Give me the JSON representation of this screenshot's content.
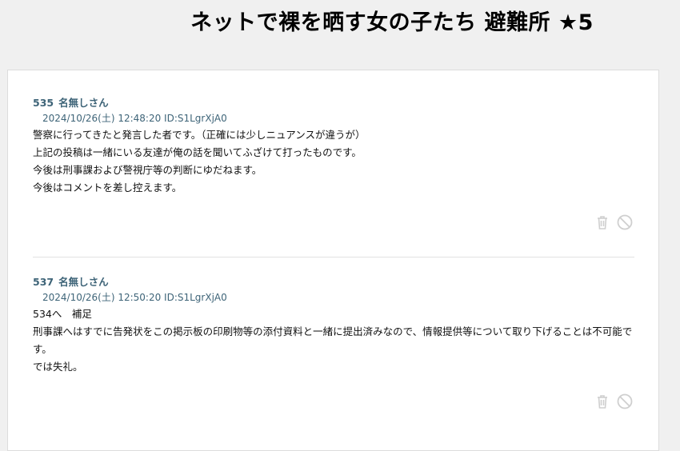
{
  "page": {
    "title": "ネットで裸を晒す女の子たち 避難所 ★5"
  },
  "posts": [
    {
      "number": "535",
      "name": "名無しさん",
      "meta": "2024/10/26(土) 12:48:20 ID:S1LgrXjA0",
      "lines": [
        "警察に行ってきたと発言した者です。（正確には少しニュアンスが違うが）",
        "上記の投稿は一緒にいる友達が俺の話を聞いてふざけて打ったものです。",
        "今後は刑事課および警視庁等の判断にゆだねます。",
        "今後はコメントを差し控えます。"
      ]
    },
    {
      "number": "537",
      "name": "名無しさん",
      "meta": "2024/10/26(土) 12:50:20 ID:S1LgrXjA0",
      "lines": [
        "534へ　補足",
        "刑事課へはすでに告発状をこの掲示板の印刷物等の添付資料と一緒に提出済みなので、情報提供等について取り下げることは不可能です。",
        "では失礼。"
      ]
    }
  ],
  "icons": {
    "delete": "trash-icon",
    "block": "block-icon"
  },
  "colors": {
    "header_text": "#3e6478",
    "icon": "#cfcfcf",
    "background": "#f0f0f0"
  }
}
